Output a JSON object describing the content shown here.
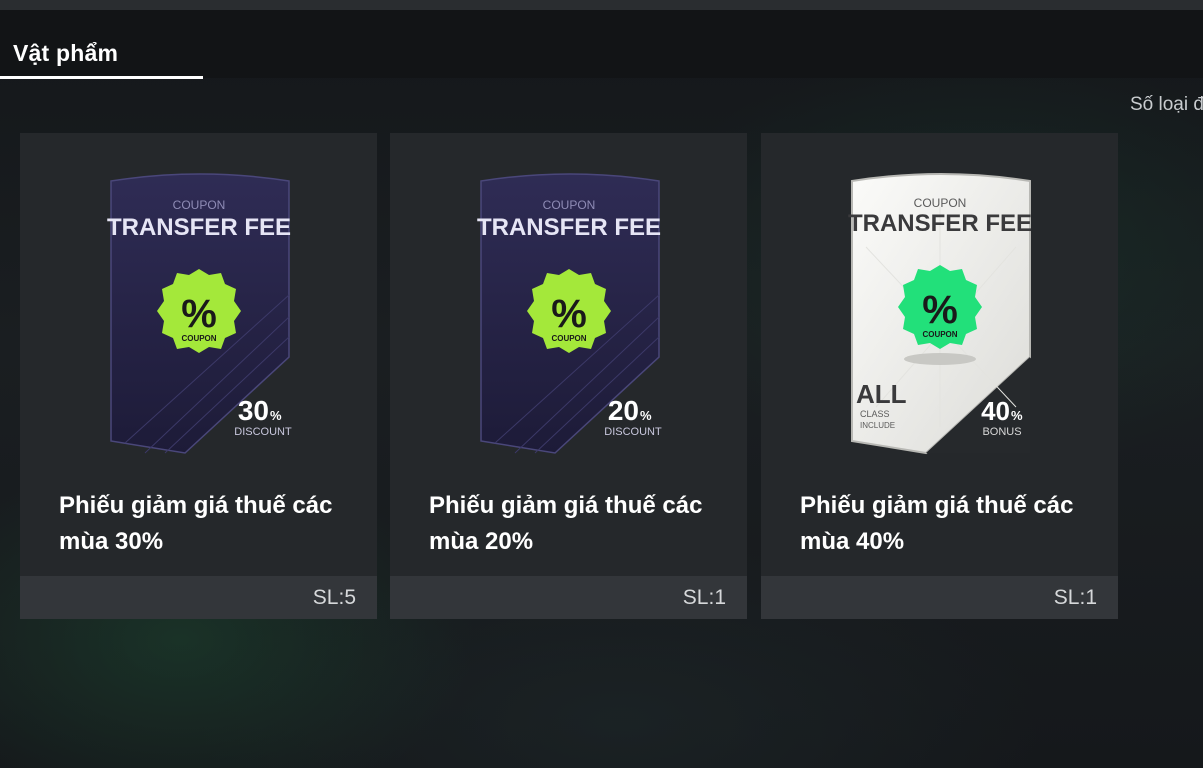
{
  "header": {
    "tab_label": "Vật phẩm"
  },
  "count_label": "Số loại đ",
  "items": [
    {
      "title": "Phiếu giảm giá thuế các mùa 30%",
      "quantity": "SL:5",
      "coupon": {
        "caption": "COUPON",
        "heading": "TRANSFER FEE",
        "badge_symbol": "%",
        "badge_text": "COUPON",
        "value": "30",
        "unit": "%",
        "sub": "DISCOUNT",
        "style": "dark",
        "badge_color": "#a4e83a"
      }
    },
    {
      "title": "Phiếu giảm giá thuế các mùa 20%",
      "quantity": "SL:1",
      "coupon": {
        "caption": "COUPON",
        "heading": "TRANSFER FEE",
        "badge_symbol": "%",
        "badge_text": "COUPON",
        "value": "20",
        "unit": "%",
        "sub": "DISCOUNT",
        "style": "dark",
        "badge_color": "#a4e83a"
      }
    },
    {
      "title": "Phiếu giảm giá thuế các mùa 40%",
      "quantity": "SL:1",
      "coupon": {
        "caption": "COUPON",
        "heading": "TRANSFER FEE",
        "badge_symbol": "%",
        "badge_text": "COUPON",
        "value": "40",
        "unit": "%",
        "sub": "BONUS",
        "style": "light",
        "badge_color": "#22e07a",
        "left_big": "ALL",
        "left_small_1": "CLASS",
        "left_small_2": "INCLUDE"
      }
    }
  ],
  "colors": {
    "dark_card_top": "#2e2b52",
    "dark_card_bottom": "#1f1d3a",
    "light_card": "#f2f2f0"
  }
}
